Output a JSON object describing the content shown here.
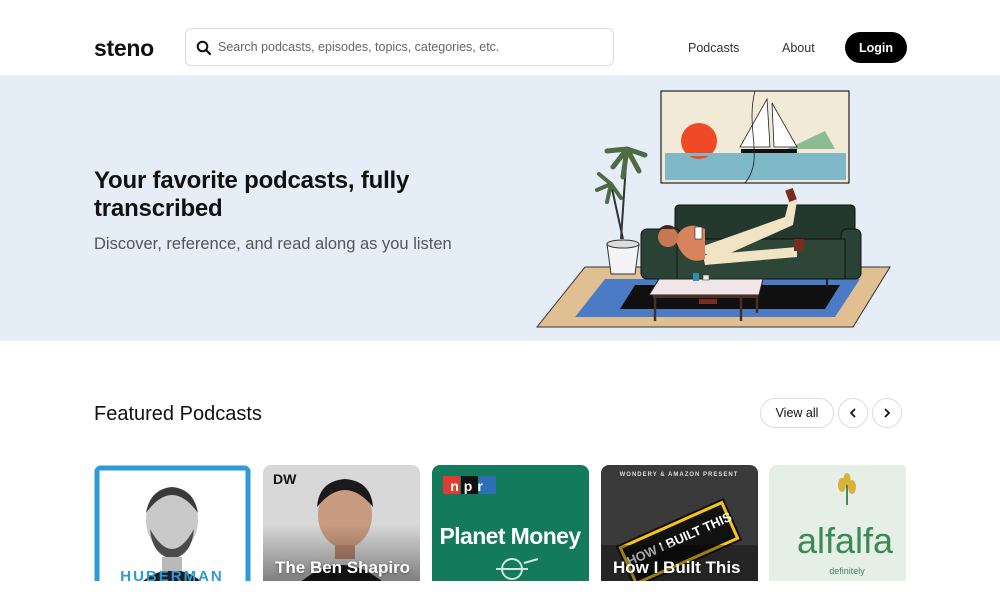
{
  "header": {
    "logo": "steno",
    "search_placeholder": "Search podcasts, episodes, topics, categories, etc.",
    "nav": {
      "podcasts": "Podcasts",
      "about": "About",
      "login": "Login"
    }
  },
  "hero": {
    "title": "Your favorite podcasts, fully transcribed",
    "subtitle": "Discover, reference, and read along as you listen"
  },
  "featured": {
    "title": "Featured Podcasts",
    "view_all": "View all",
    "cards": [
      {
        "title": "",
        "art_text": "HUBERMAN"
      },
      {
        "title": "The Ben Shapiro",
        "badge": "DW"
      },
      {
        "title": "",
        "badge": "npr",
        "art_text": "Planet Money"
      },
      {
        "title": "How I Built This",
        "art_text": "HOW I BUILT THIS",
        "header": "WONDERY & AMAZON PRESENT"
      },
      {
        "title": "",
        "art_text": "alfalfa",
        "sub": "definitely"
      }
    ]
  },
  "colors": {
    "hero_bg": "#e5edf7",
    "login_bg": "#000000",
    "planet_money_green": "#137a5c",
    "huberman_frame": "#2e9bd6"
  },
  "icons": [
    "search-icon",
    "chevron-left-icon",
    "chevron-right-icon"
  ]
}
